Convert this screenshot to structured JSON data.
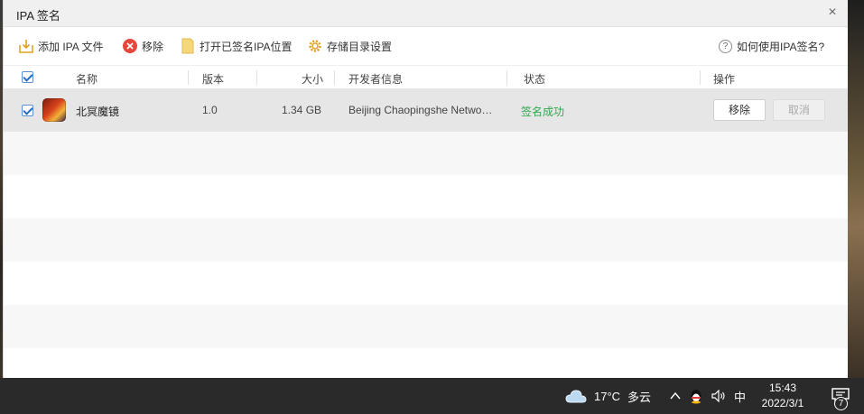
{
  "window": {
    "title": "IPA 签名",
    "close_symbol": "×"
  },
  "toolbar": {
    "add_label": "添加 IPA 文件",
    "add_icon": "download-folder-icon",
    "remove_label": "移除",
    "remove_icon": "remove-circle-icon",
    "open_location_label": "打开已签名IPA位置",
    "open_location_icon": "folder-icon",
    "storage_settings_label": "存储目录设置",
    "storage_settings_icon": "gear-icon",
    "help_label": "如何使用IPA签名?",
    "help_icon": "question-circle-icon",
    "help_symbol": "?"
  },
  "table": {
    "columns": [
      "名称",
      "版本",
      "大小",
      "开发者信息",
      "状态",
      "操作"
    ],
    "rows": [
      {
        "checked": true,
        "name": "北冥魔镜",
        "version": "1.0",
        "size": "1.34 GB",
        "developer": "Beijing Chaopingshe Netwo…",
        "status": "签名成功",
        "status_color": "#2fa84f",
        "action_remove": "移除",
        "action_cancel": "取消"
      }
    ]
  },
  "taskbar": {
    "weather_icon": "cloud-icon",
    "temperature": "17°C",
    "weather": "多云",
    "ime": "中",
    "time": "15:43",
    "date": "2022/3/1",
    "notification_count": "7"
  },
  "colors": {
    "accent": "#2b6cc4",
    "success": "#2fa84f",
    "selected_row": "#e6e6e6"
  }
}
